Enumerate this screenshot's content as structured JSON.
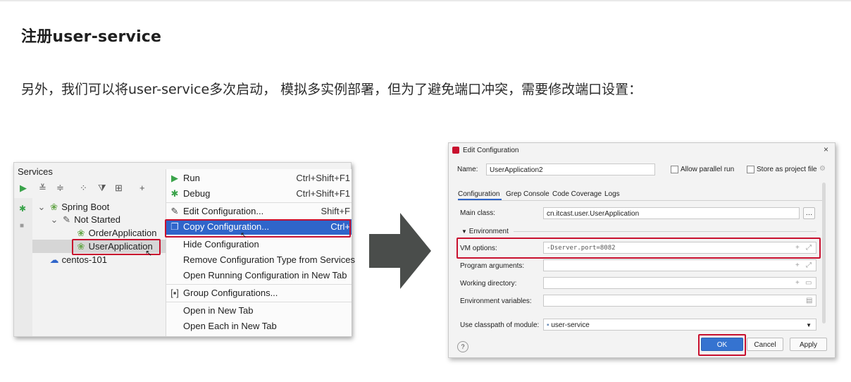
{
  "heading": "注册user-service",
  "paragraph": "另外，我们可以将user-service多次启动， 模拟多实例部署，但为了避免端口冲突，需要修改端口设置：",
  "services": {
    "title": "Services",
    "tree": {
      "spring_boot": "Spring Boot",
      "not_started": "Not Started",
      "order_app": "OrderApplication",
      "user_app": "UserApplication",
      "centos": "centos-101"
    },
    "menu": [
      {
        "label": "Run",
        "shortcut": "Ctrl+Shift+F1"
      },
      {
        "label": "Debug",
        "shortcut": "Ctrl+Shift+F1"
      },
      {
        "label": "Edit Configuration...",
        "shortcut": "Shift+F"
      },
      {
        "label": "Copy Configuration...",
        "shortcut": "Ctrl+"
      },
      {
        "label": "Hide Configuration",
        "shortcut": ""
      },
      {
        "label": "Remove Configuration Type from Services",
        "shortcut": ""
      },
      {
        "label": "Open Running Configuration in New Tab",
        "shortcut": ""
      },
      {
        "label": "Group Configurations...",
        "shortcut": ""
      },
      {
        "label": "Open in New Tab",
        "shortcut": ""
      },
      {
        "label": "Open Each in New Tab",
        "shortcut": ""
      }
    ]
  },
  "dialog": {
    "title": "Edit Configuration",
    "name_label": "Name:",
    "name_value": "UserApplication2",
    "allow_parallel": "Allow parallel run",
    "store_project": "Store as project file",
    "tabs": [
      "Configuration",
      "Grep Console",
      "Code Coverage",
      "Logs"
    ],
    "main_class_label": "Main class:",
    "main_class_value": "cn.itcast.user.UserApplication",
    "environment": "Environment",
    "vm_label": "VM options:",
    "vm_value": "-Dserver.port=8082",
    "program_args": "Program arguments:",
    "working_dir": "Working directory:",
    "env_vars": "Environment variables:",
    "classpath_label": "Use classpath of module:",
    "classpath_value": "user-service",
    "ok": "OK",
    "cancel": "Cancel",
    "apply": "Apply",
    "help": "?"
  },
  "colors": {
    "highlight_red": "#c8102e",
    "selection_blue": "#2f65ca",
    "arrow_gray": "#4a4d4b"
  }
}
